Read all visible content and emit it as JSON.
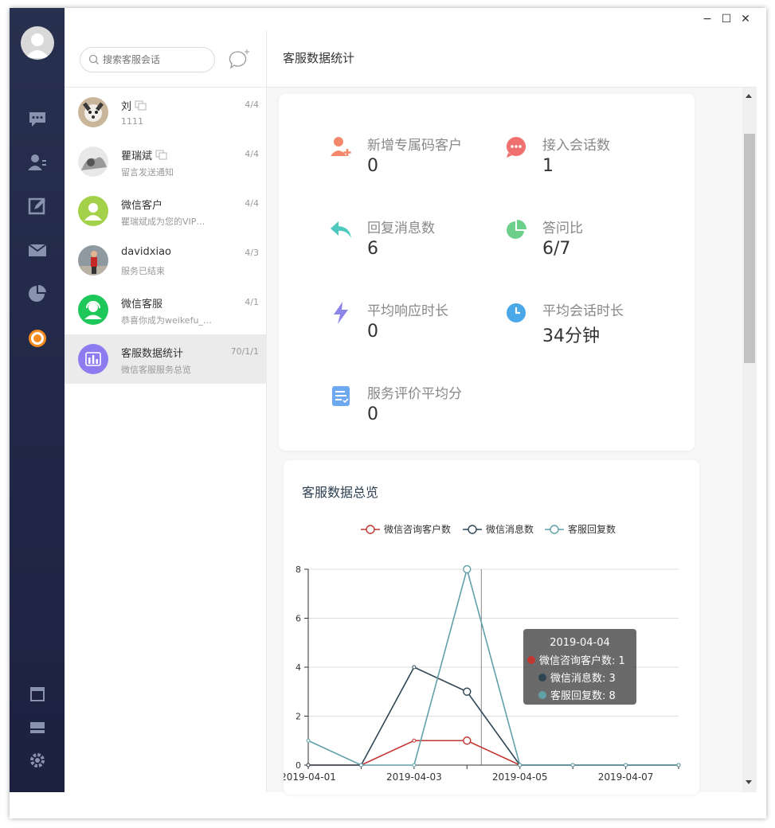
{
  "window": {
    "minimize": "−",
    "maximize": "☐",
    "close": "✕"
  },
  "search": {
    "placeholder": "搜索客服会话"
  },
  "conversations": [
    {
      "name": "刘",
      "sub": "1111",
      "date": "4/4",
      "avatar": "dog-photo",
      "copy": true
    },
    {
      "name": "瞿瑞斌",
      "sub": "留言发送通知",
      "date": "4/4",
      "avatar": "bw-photo",
      "copy": true
    },
    {
      "name": "微信客户",
      "sub": "瞿瑞斌成为您的VIP…",
      "date": "4/4",
      "avatar": "user-green",
      "copy": false
    },
    {
      "name": "davidxiao",
      "sub": "服务已结束",
      "date": "4/3",
      "avatar": "person-photo",
      "copy": false
    },
    {
      "name": "微信客服",
      "sub": "恭喜你成为weikefu_…",
      "date": "4/1",
      "avatar": "service-green",
      "copy": false
    },
    {
      "name": "客服数据统计",
      "sub": "微信客服服务总览",
      "date": "70/1/1",
      "avatar": "stats-purple",
      "copy": false,
      "active": true
    }
  ],
  "main": {
    "title": "客服数据统计"
  },
  "stats": [
    {
      "label": "新增专属码客户",
      "value": "0",
      "icon": "add-user-icon",
      "color": "#f5886b"
    },
    {
      "label": "接入会话数",
      "value": "1",
      "icon": "chat-bubble-icon",
      "color": "#f07070"
    },
    {
      "label": "回复消息数",
      "value": "6",
      "icon": "reply-icon",
      "color": "#4fc9c0"
    },
    {
      "label": "答问比",
      "value": "6/7",
      "icon": "pie-icon",
      "color": "#6ccf8a"
    },
    {
      "label": "平均响应时长",
      "value": "0",
      "icon": "lightning-icon",
      "color": "#8b86e8"
    },
    {
      "label": "平均会话时长",
      "value": "34分钟",
      "icon": "clock-icon",
      "color": "#4aa8e8"
    },
    {
      "label": "服务评价平均分",
      "value": "0",
      "icon": "form-icon",
      "color": "#6ea8f0"
    }
  ],
  "chart_title": "客服数据总览",
  "chart_data": {
    "type": "line",
    "x": [
      "2019-04-01",
      "2019-04-02",
      "2019-04-03",
      "2019-04-04",
      "2019-04-05",
      "2019-04-06",
      "2019-04-07",
      "2019-04-08"
    ],
    "x_tick_labels": [
      "2019-04-01",
      "2019-04-03",
      "2019-04-05",
      "2019-04-07"
    ],
    "ylim": [
      0,
      8
    ],
    "y_ticks": [
      0,
      2,
      4,
      6,
      8
    ],
    "grid": true,
    "legend": "top",
    "series": [
      {
        "name": "微信咨询客户数",
        "color": "#c23531",
        "values": [
          0,
          0,
          1,
          1,
          0,
          0,
          0,
          0
        ]
      },
      {
        "name": "微信消息数",
        "color": "#2f4554",
        "values": [
          0,
          0,
          4,
          3,
          0,
          0,
          0,
          0
        ]
      },
      {
        "name": "客服回复数",
        "color": "#61a0a8",
        "values": [
          1,
          0,
          0,
          8,
          0,
          0,
          0,
          0
        ]
      }
    ],
    "tooltip": {
      "title": "2019-04-04",
      "lines": [
        "微信咨询客户数: 1",
        "微信消息数: 3",
        "客服回复数: 8"
      ]
    }
  }
}
